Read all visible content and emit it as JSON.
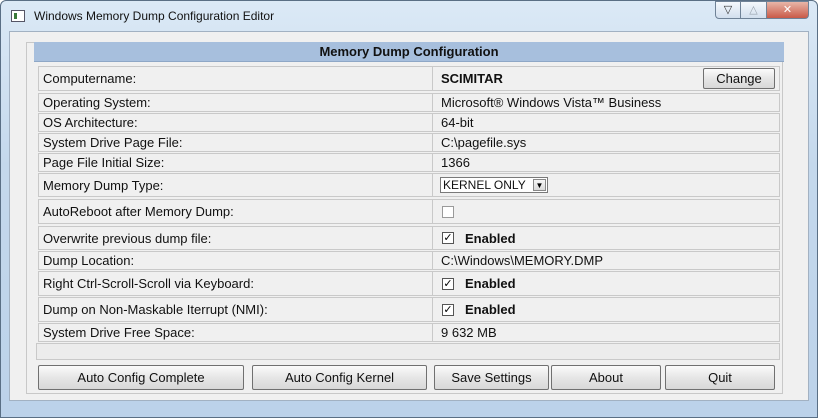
{
  "window": {
    "title": "Windows Memory Dump Configuration Editor",
    "controls": {
      "minimize": "▽",
      "maximize": "△",
      "close": "✕"
    }
  },
  "panel": {
    "header": "Memory Dump Configuration",
    "rows": {
      "computername": {
        "label": "Computername:",
        "value": "SCIMITAR",
        "button": "Change"
      },
      "os": {
        "label": "Operating System:",
        "value": "Microsoft® Windows Vista™ Business"
      },
      "arch": {
        "label": "OS Architecture:",
        "value": "64-bit"
      },
      "pagefile": {
        "label": "System Drive Page File:",
        "value": "C:\\pagefile.sys"
      },
      "pagefile_size": {
        "label": "Page File Initial Size:",
        "value": "1366"
      },
      "dump_type": {
        "label": "Memory Dump Type:",
        "selected": "KERNEL ONLY"
      },
      "autoreboot": {
        "label": "AutoReboot after Memory Dump:",
        "checked": false
      },
      "overwrite": {
        "label": "Overwrite previous dump file:",
        "checked": true,
        "state_label": "Enabled"
      },
      "dump_location": {
        "label": "Dump Location:",
        "value": "C:\\Windows\\MEMORY.DMP"
      },
      "ctrl_scroll": {
        "label": "Right Ctrl-Scroll-Scroll via Keyboard:",
        "checked": true,
        "state_label": "Enabled"
      },
      "nmi": {
        "label": "Dump on Non-Maskable Iterrupt (NMI):",
        "checked": true,
        "state_label": "Enabled"
      },
      "free_space": {
        "label": "System Drive Free Space:",
        "value": "9 632 MB"
      }
    }
  },
  "buttons": {
    "auto_config_complete": "Auto Config Complete",
    "auto_config_kernel": "Auto Config Kernel",
    "save_settings": "Save Settings",
    "about": "About",
    "quit": "Quit"
  },
  "icons": {
    "check_glyph": "✓",
    "dropdown_glyph": "▼",
    "app_icon": "window-app-icon"
  }
}
